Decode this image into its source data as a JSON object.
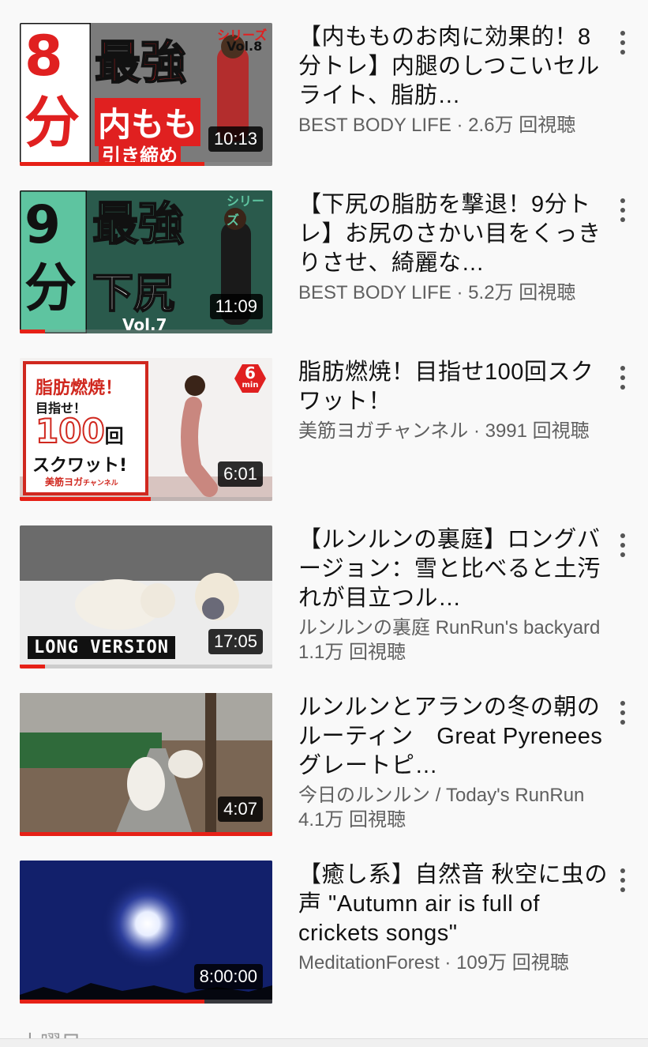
{
  "videos": [
    {
      "title": "【内もものお肉に効果的！8分トレ】内腿のしつこいセルライト、脂肪…",
      "meta": "BEST BODY LIFE · 2.6万 回視聴",
      "duration": "10:13",
      "progress": 0.73,
      "thumb_text": {
        "big": "8分",
        "main": "最強",
        "sub": "内もも",
        "sub2": "引き締め",
        "series": "シリーズ",
        "vol": "Vol.8"
      }
    },
    {
      "title": "【下尻の脂肪を撃退！9分トレ】お尻のさかい目をくっきりさせ、綺麗な…",
      "meta": "BEST BODY LIFE · 5.2万 回視聴",
      "duration": "11:09",
      "progress": 0.1,
      "thumb_text": {
        "big": "9分",
        "main": "最強",
        "sub": "下尻",
        "series": "シリーズ",
        "vol": "Vol.7"
      }
    },
    {
      "title": "脂肪燃焼！目指せ100回スクワット！",
      "meta": "美筋ヨガチャンネル · 3991 回視聴",
      "duration": "6:01",
      "progress": 0.52,
      "thumb_text": {
        "l1": "脂肪燃焼！",
        "l2": "目指せ！",
        "l3": "100",
        "l3b": "回",
        "l4": "スクワット!",
        "l5": "美筋ヨガ",
        "l5b": "チャンネル",
        "badge": "6",
        "badge_unit": "min"
      }
    },
    {
      "title": "【ルンルンの裏庭】ロングバージョン：雪と比べると土汚れが目立つル…",
      "meta": "ルンルンの裏庭 RunRun's backyard 1.1万 回視聴",
      "duration": "17:05",
      "progress": 0.1,
      "thumb_text": {
        "tag": "LONG VERSION"
      }
    },
    {
      "title": "ルンルンとアランの冬の朝のルーティン　Great Pyrenees　グレートピ…",
      "meta": "今日のルンルン / Today's RunRun 4.1万 回視聴",
      "duration": "4:07",
      "progress": 1.0
    },
    {
      "title": "【癒し系】自然音 秋空に虫の声 \"Autumn air is full of crickets songs\"",
      "meta": "MeditationForest · 109万 回視聴",
      "duration": "8:00:00",
      "progress": 0.73
    }
  ],
  "cut_heading": "土曜日",
  "colors": {
    "progress": "#e62117",
    "meta": "#606060",
    "title": "#111111"
  },
  "icons": {
    "menu": "more-vert-icon"
  }
}
